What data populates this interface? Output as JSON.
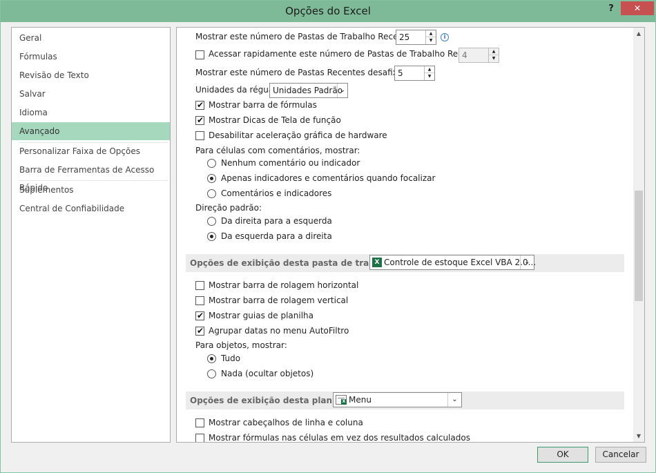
{
  "window": {
    "title": "Opções do Excel",
    "help_label": "?",
    "close_label": "✕"
  },
  "nav": {
    "items": [
      {
        "label": "Geral",
        "active": false
      },
      {
        "label": "Fórmulas",
        "active": false
      },
      {
        "label": "Revisão de Texto",
        "active": false
      },
      {
        "label": "Salvar",
        "active": false
      },
      {
        "label": "Idioma",
        "active": false
      },
      {
        "label": "Avançado",
        "active": true
      },
      {
        "label": "Personalizar Faixa de Opções",
        "active": false
      },
      {
        "label": "Barra de Ferramentas de Acesso Rápido",
        "active": false
      },
      {
        "label": "Suplementos",
        "active": false
      },
      {
        "label": "Central de Confiabilidade",
        "active": false
      }
    ]
  },
  "display": {
    "recent_workbooks_label": "Mostrar este número de Pastas de Trabalho Recentes:",
    "recent_workbooks_value": "25",
    "quick_access_label": "Acessar rapidamente este número de Pastas de Trabalho Recentes:",
    "quick_access_value": "4",
    "quick_access_checked": false,
    "recent_folders_label": "Mostrar este número de Pastas Recentes desafixadas:",
    "recent_folders_value": "5",
    "ruler_units_label": "Unidades da régua",
    "ruler_units_value": "Unidades Padrão",
    "show_formula_bar_label": "Mostrar barra de fórmulas",
    "show_formula_bar_checked": true,
    "show_function_tips_label": "Mostrar Dicas de Tela de função",
    "show_function_tips_checked": true,
    "disable_hw_accel_label": "Desabilitar aceleração gráfica de hardware",
    "disable_hw_accel_checked": false,
    "comments_group_label": "Para células com comentários, mostrar:",
    "comments_options": [
      {
        "label": "Nenhum comentário ou indicador",
        "selected": false
      },
      {
        "label": "Apenas indicadores e comentários quando focalizar",
        "selected": true
      },
      {
        "label": "Comentários e indicadores",
        "selected": false
      }
    ],
    "direction_group_label": "Direção padrão:",
    "direction_options": [
      {
        "label": "Da direita para a esquerda",
        "selected": false
      },
      {
        "label": "Da esquerda para a direita",
        "selected": true
      }
    ]
  },
  "workbook_section": {
    "title": "Opções de exibição desta pasta de trabalho:",
    "selected_workbook": "Controle de estoque Excel VBA 2.0...",
    "options": [
      {
        "label": "Mostrar barra de rolagem horizontal",
        "checked": false
      },
      {
        "label": "Mostrar barra de rolagem vertical",
        "checked": false
      },
      {
        "label": "Mostrar guias de planilha",
        "checked": true
      },
      {
        "label": "Agrupar datas no menu AutoFiltro",
        "checked": true
      }
    ],
    "objects_group_label": "Para objetos, mostrar:",
    "objects_options": [
      {
        "label": "Tudo",
        "selected": true
      },
      {
        "label": "Nada (ocultar objetos)",
        "selected": false
      }
    ]
  },
  "sheet_section": {
    "title": "Opções de exibição desta planilha:",
    "selected_sheet": "Menu",
    "options": [
      {
        "label": "Mostrar cabeçalhos de linha e coluna",
        "checked": false
      },
      {
        "label": "Mostrar fórmulas nas células em vez dos resultados calculados",
        "checked": false
      }
    ]
  },
  "buttons": {
    "ok_label": "OK",
    "cancel_label": "Cancelar"
  },
  "icons": {
    "check_glyph": "✔",
    "info_glyph": "i",
    "dropdown_glyph": "⌄",
    "spin_up_glyph": "▲",
    "spin_down_glyph": "▼",
    "scroll_up_glyph": "▲",
    "scroll_down_glyph": "▼",
    "excel_glyph": "X"
  },
  "colors": {
    "accent": "#7fba98",
    "nav_active": "#a6d8bd",
    "close_red": "#c75050",
    "excel_green": "#1e7145"
  }
}
